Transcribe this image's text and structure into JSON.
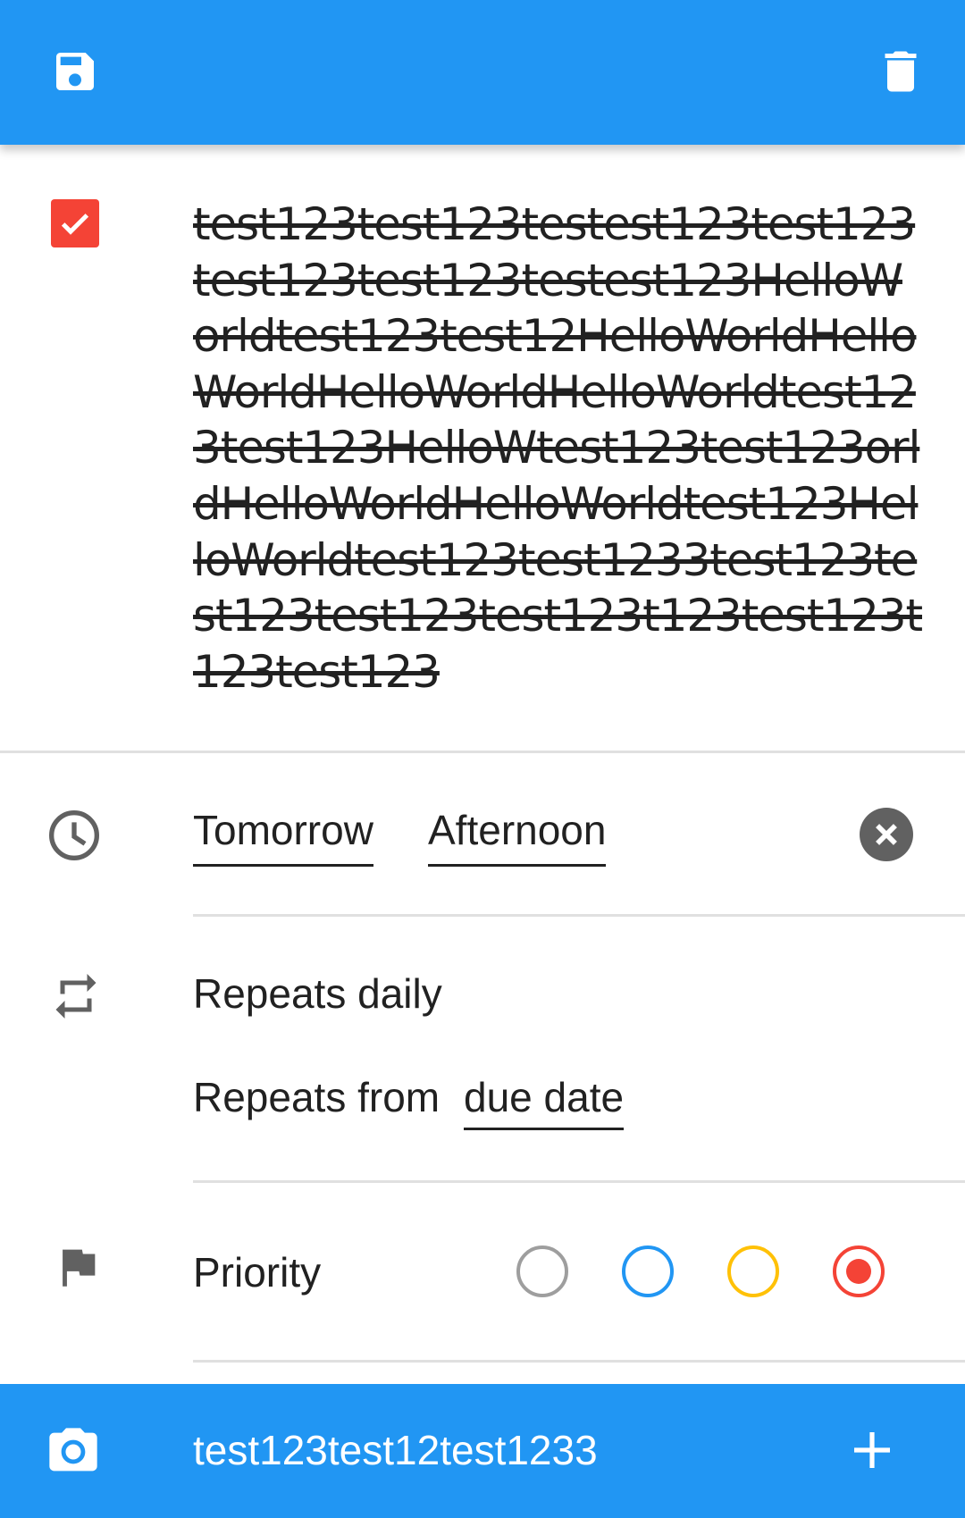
{
  "toolbar": {
    "save_icon": "save-icon",
    "delete_icon": "delete-icon",
    "background_color": "#2196f3"
  },
  "task": {
    "completed": true,
    "checkbox_color": "#f44336",
    "title": "test123test123testest123test123test123test123testest123HelloWorldtest123test12HelloWorldHelloWorldHelloWorldHelloWorldtest123test123HelloWtest123test123orldHelloWorldHelloWorldtest123HelloWorldtest123test1233test123test123test123test123t123test123t123test123"
  },
  "due": {
    "icon": "clock-icon",
    "day": "Tomorrow",
    "time": "Afternoon",
    "clear_icon": "close-icon"
  },
  "repeat": {
    "icon": "repeat-icon",
    "text": "Repeats daily",
    "from_label": "Repeats from",
    "from_value": "due date"
  },
  "priority": {
    "icon": "flag-icon",
    "label": "Priority",
    "options": [
      {
        "name": "none",
        "color": "#9e9e9e",
        "selected": false
      },
      {
        "name": "low",
        "color": "#2196f3",
        "selected": false
      },
      {
        "name": "medium",
        "color": "#ffc107",
        "selected": false
      },
      {
        "name": "high",
        "color": "#f44336",
        "selected": true
      }
    ]
  },
  "bottom_bar": {
    "camera_icon": "camera-icon",
    "text": "test123test12test1233",
    "add_icon": "plus-icon"
  }
}
